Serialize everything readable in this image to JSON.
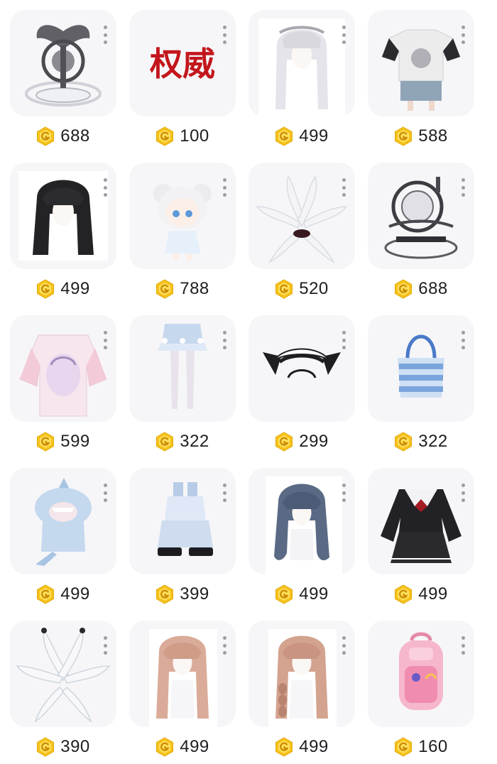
{
  "colors": {
    "coin": "#f6c21a",
    "price_text": "#1e1e22",
    "card_bg": "#f6f6f8",
    "accent_red": "#c3161c"
  },
  "currency_icon": "g-coin-icon",
  "items": [
    {
      "name": "winged-emblem-effect",
      "icon": "winged-emblem-icon",
      "price": "688"
    },
    {
      "name": "authority-title-text",
      "icon": "authority-title-icon",
      "title_text": "权威",
      "price": "100"
    },
    {
      "name": "silver-twin-tail-hair",
      "icon": "twin-tail-hair-icon",
      "price": "499"
    },
    {
      "name": "graphic-tee-skirt-outfit",
      "icon": "tshirt-icon",
      "price": "588"
    },
    {
      "name": "black-long-hair",
      "icon": "long-hair-icon",
      "price": "499"
    },
    {
      "name": "chibi-doll-companion",
      "icon": "doll-icon",
      "price": "788"
    },
    {
      "name": "white-tentacles",
      "icon": "tentacles-icon",
      "price": "520"
    },
    {
      "name": "orb-globe-effect",
      "icon": "orb-effect-icon",
      "price": "688"
    },
    {
      "name": "pink-anime-sweater",
      "icon": "sweater-icon",
      "price": "599"
    },
    {
      "name": "ruffle-shorts-tights",
      "icon": "shorts-icon",
      "price": "322"
    },
    {
      "name": "cat-ear-maid-headband",
      "icon": "cat-ear-headband-icon",
      "price": "299"
    },
    {
      "name": "striped-tote-bag",
      "icon": "tote-bag-icon",
      "price": "322"
    },
    {
      "name": "shark-hoodie-onesie",
      "icon": "shark-hoodie-icon",
      "price": "499"
    },
    {
      "name": "blue-boots-socks",
      "icon": "boots-icon",
      "price": "399"
    },
    {
      "name": "blue-grey-wavy-hair",
      "icon": "wavy-hair-icon",
      "price": "499"
    },
    {
      "name": "black-sailor-dress",
      "icon": "sailor-dress-icon",
      "price": "499"
    },
    {
      "name": "white-tentacle-wings",
      "icon": "tentacle-wings-icon",
      "price": "390"
    },
    {
      "name": "peach-long-hair",
      "icon": "peach-hair-icon",
      "price": "499"
    },
    {
      "name": "peach-braided-hair",
      "icon": "braided-hair-icon",
      "price": "499"
    },
    {
      "name": "pink-backpack",
      "icon": "backpack-icon",
      "price": "160"
    }
  ]
}
